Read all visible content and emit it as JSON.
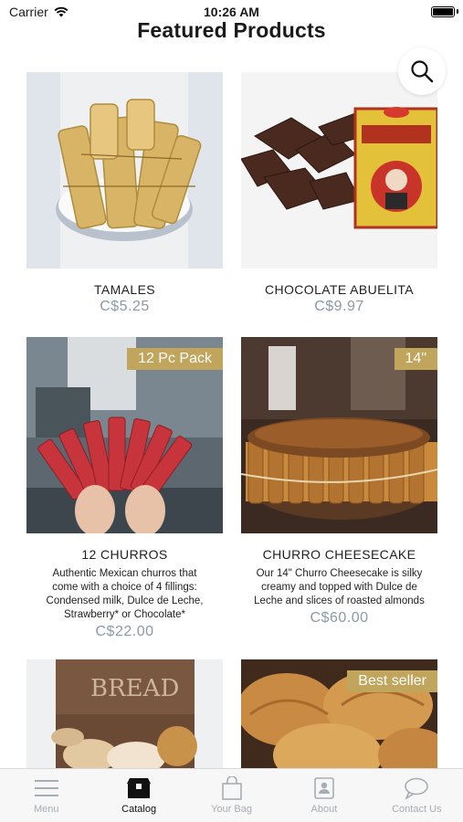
{
  "status_bar": {
    "carrier": "Carrier",
    "time": "10:26 AM",
    "battery_level": 1.0
  },
  "page": {
    "title": "Featured Products"
  },
  "search": {
    "icon": "search-icon"
  },
  "products": [
    {
      "name": "TAMALES",
      "price": "C$5.25",
      "badge": "",
      "description": ""
    },
    {
      "name": "CHOCOLATE ABUELITA",
      "price": "C$9.97",
      "badge": "",
      "description": ""
    },
    {
      "name": "12 CHURROS",
      "price": "C$22.00",
      "badge": "12 Pc Pack",
      "description": [
        "Authentic Mexican churros that",
        "come with a choice of 4 fillings:",
        "Condensed milk, Dulce de Leche,",
        "Strawberry* or Chocolate*"
      ]
    },
    {
      "name": "CHURRO CHEESECAKE",
      "price": "C$60.00",
      "badge": "14\"",
      "description": [
        "Our 14\" Churro Cheesecake is silky",
        "creamy and topped with Dulce de",
        "Leche and slices of roasted almonds"
      ]
    },
    {
      "name": "",
      "price": "",
      "badge": "",
      "description": ""
    },
    {
      "name": "",
      "price": "",
      "badge": "Best seller",
      "description": ""
    }
  ],
  "tab_bar": {
    "tabs": [
      {
        "label": "Menu",
        "icon": "menu-icon",
        "active": false
      },
      {
        "label": "Catalog",
        "icon": "catalog-icon",
        "active": true
      },
      {
        "label": "Your Bag",
        "icon": "bag-icon",
        "active": false
      },
      {
        "label": "About",
        "icon": "about-icon",
        "active": false
      },
      {
        "label": "Contact Us",
        "icon": "chat-icon",
        "active": false
      }
    ]
  },
  "colors": {
    "badge": "#c2a55c",
    "price": "#8c99a6",
    "tab_inactive": "#a6adb4",
    "tab_active": "#111111"
  }
}
